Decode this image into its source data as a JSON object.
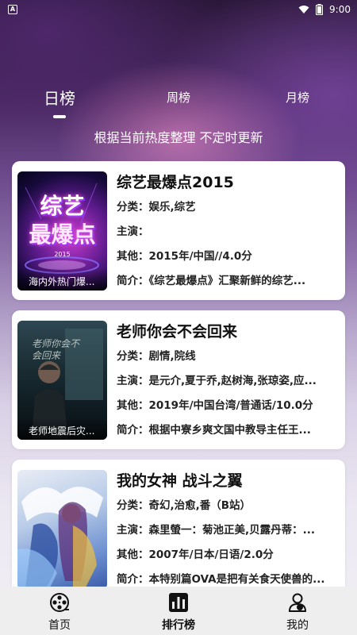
{
  "statusbar": {
    "time": "9:00",
    "notification": "A"
  },
  "tabs": [
    {
      "label": "日榜",
      "active": true
    },
    {
      "label": "周榜",
      "active": false
    },
    {
      "label": "月榜",
      "active": false
    }
  ],
  "subtitle": "根据当前热度整理 不定时更新",
  "items": [
    {
      "title": "综艺最爆点2015",
      "category": "分类：娱乐,综艺",
      "cast": "主演：",
      "other": "其他：2015年/中国//4.0分",
      "intro": "简介：《综艺最爆点》汇聚新鲜的综艺...",
      "poster_caption": "海内外热门爆...",
      "poster_lines": [
        "综艺",
        "最爆点",
        "2015"
      ]
    },
    {
      "title": "老师你会不会回来",
      "category": "分类：剧情,院线",
      "cast": "主演：是元介,夏于乔,赵树海,张琼姿,应...",
      "other": "其他：2019年/中国台湾/普通话/10.0分",
      "intro": "简介：根据中寮乡爽文国中教导主任王...",
      "poster_caption": "老师地震后灾...",
      "poster_lines": [
        "老师你会不会回来"
      ]
    },
    {
      "title": "我的女神 战斗之翼",
      "category": "分类：奇幻,治愈,番（B站）",
      "cast": "主演：森里螢一：菊池正美,贝露丹蒂：...",
      "other": "其他：2007年/日本/日语/2.0分",
      "intro": "简介：本特别篇OVA是把有关食天使兽的...",
      "poster_caption": "",
      "poster_lines": []
    }
  ],
  "nav": [
    {
      "label": "首页",
      "icon": "film-reel-icon",
      "active": false
    },
    {
      "label": "排行榜",
      "icon": "ranking-chart-icon",
      "active": true
    },
    {
      "label": "我的",
      "icon": "user-profile-icon",
      "active": false
    }
  ]
}
